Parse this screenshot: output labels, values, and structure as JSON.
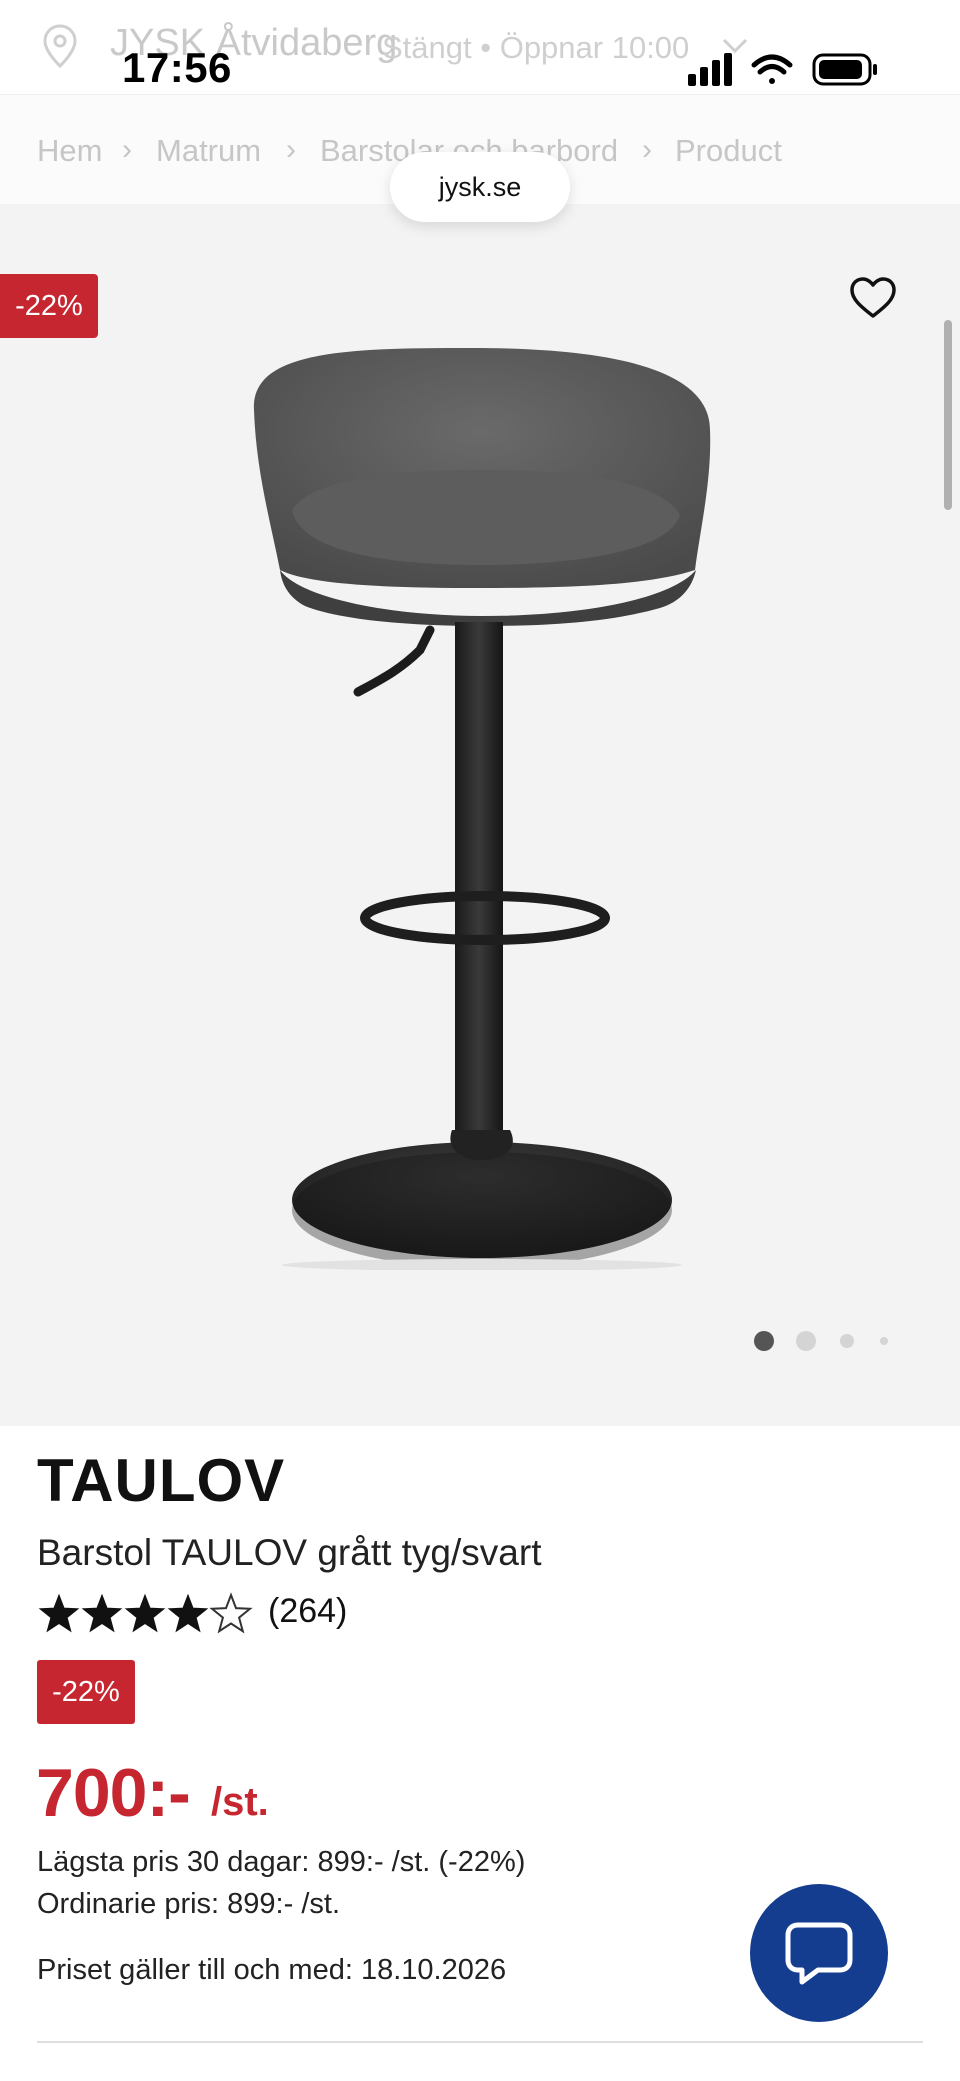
{
  "store": {
    "name": "JYSK Åtvidaberg",
    "status": "Stängt • Öppnar 10:00",
    "pin_icon": "location-pin-icon",
    "chevron_icon": "chevron-down-icon"
  },
  "status_bar": {
    "time": "17:56",
    "icons": [
      "cellular-signal-icon",
      "wifi-icon",
      "battery-icon"
    ]
  },
  "breadcrumb": {
    "items": [
      "Hem",
      "Matrum",
      "Barstolar och barbord",
      "Product"
    ],
    "separator": "›"
  },
  "browser": {
    "url": "jysk.se"
  },
  "gallery": {
    "discount_badge": "-22%",
    "favorite_icon": "heart-outline-icon",
    "image_count": 4,
    "active_index": 0
  },
  "product": {
    "brand": "TAULOV",
    "description": "Barstol TAULOV grått tyg/svart",
    "rating": 4,
    "rating_max": 5,
    "review_count": "(264)",
    "discount_badge": "-22%",
    "price": "700:-",
    "price_unit": "/st.",
    "lowest_price_30_days": "Lägsta pris 30 dagar: 899:- /st. (-22%)",
    "ordinary_price": "Ordinarie pris: 899:- /st.",
    "valid_until": "Priset gäller till och med: 18.10.2026"
  },
  "chat": {
    "icon": "chat-bubble-icon"
  },
  "colors": {
    "sale_red": "#c62630",
    "chat_blue": "#143d8f",
    "gallery_bg": "#f3f3f3"
  }
}
